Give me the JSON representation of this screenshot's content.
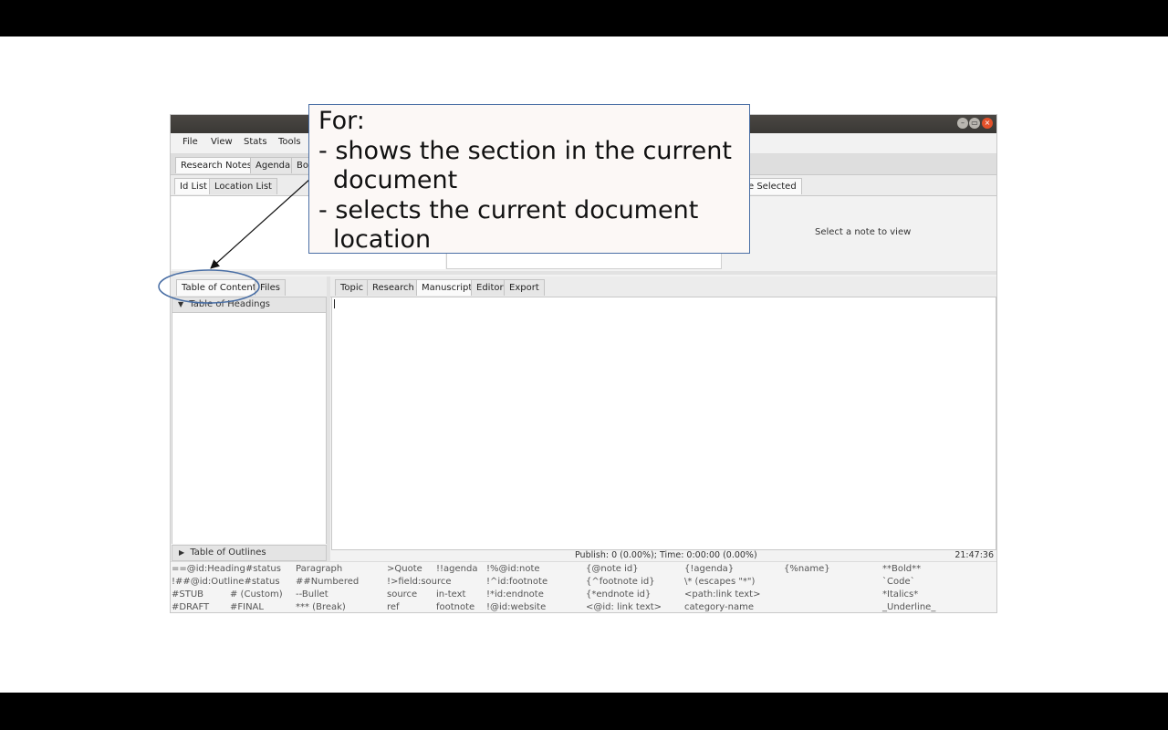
{
  "window": {
    "minimize_glyph": "–",
    "maximize_glyph": "▭",
    "close_glyph": "×"
  },
  "menu": [
    "File",
    "View",
    "Stats",
    "Tools"
  ],
  "top_tabs": [
    "Research Notes",
    "Agenda",
    "Bo"
  ],
  "notes_tabs": [
    "Id List",
    "Location List"
  ],
  "note_view": {
    "tab_partial": "e Selected",
    "placeholder": "Select a note to view"
  },
  "left_tabs": [
    "Table of Content",
    "Files"
  ],
  "toc": {
    "headings_label": "Table of Headings",
    "outlines_label": "Table of Outlines",
    "expanded_glyph": "▼",
    "collapsed_glyph": "▶"
  },
  "editor_tabs": [
    "Topic",
    "Research",
    "Manuscript",
    "Editor",
    "Export"
  ],
  "editor_selected": "Manuscript",
  "status": {
    "publish": "Publish: 0 (0.00%); Time: 0:00:00 (0.00%)",
    "clock": "21:47:36"
  },
  "syntax_hints": [
    [
      "==@id:Heading#status",
      "Paragraph",
      ">Quote",
      "!!agenda",
      "!%@id:note",
      "{@note id}",
      "{!agenda}",
      "{%name}",
      "**Bold**"
    ],
    [
      "!##@id:Outline#status",
      "##Numbered",
      "!>field:source",
      "!^id:footnote",
      "{^footnote id}",
      "\\* (escapes \"*\")",
      "`Code`"
    ],
    [
      "#STUB",
      "# (Custom)",
      "--Bullet",
      "source",
      "in-text",
      "!*id:endnote",
      "{*endnote id}",
      "<path:link text>",
      "*Italics*"
    ],
    [
      "#DRAFT",
      "#FINAL",
      "*** (Break)",
      "ref",
      "footnote",
      "!@id:website",
      "<@id: link text>",
      "category-name",
      "_Underline_"
    ]
  ],
  "callout": {
    "title": "For:",
    "line1": "- shows the section in the current",
    "line1b": "document",
    "line2": "- selects the current document",
    "line2b": "location"
  },
  "colors": {
    "accent_ellipse": "#4a6fa5",
    "close_button": "#e5512a"
  }
}
